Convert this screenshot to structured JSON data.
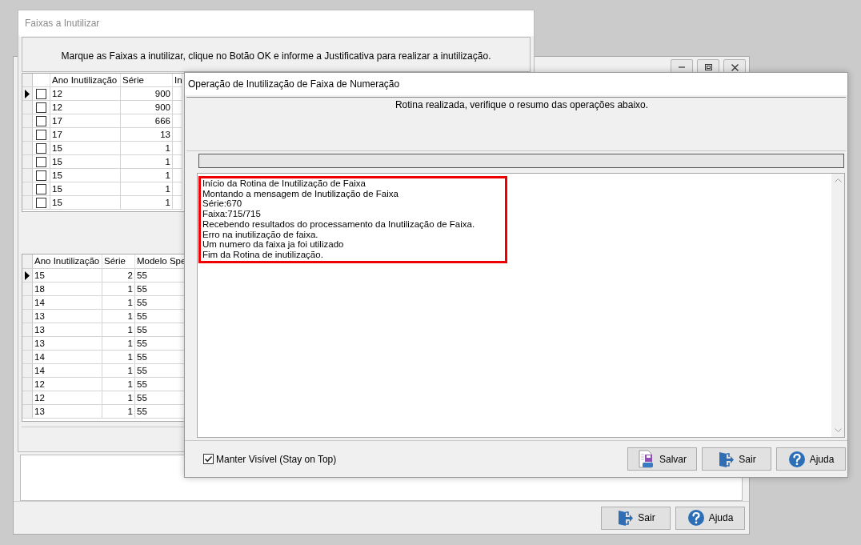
{
  "back_window": {
    "title_controls": [
      {
        "kind": "minimize"
      },
      {
        "kind": "maximize"
      },
      {
        "kind": "close"
      }
    ],
    "buttons": [
      {
        "label": "Sair",
        "kind": "exit"
      },
      {
        "label": "Ajuda",
        "kind": "help"
      }
    ]
  },
  "faixas_window": {
    "title": "Faixas a Inutilizar",
    "instruction": "Marque as Faixas a inutilizar, clique no Botão OK e informe a Justificativa para realizar a inutilização.",
    "grid_top": {
      "columns": [
        "Ano Inutilização",
        "Série",
        "In"
      ],
      "rows": [
        {
          "current": true,
          "checked": false,
          "cells": [
            "12",
            "900"
          ]
        },
        {
          "current": false,
          "checked": false,
          "cells": [
            "12",
            "900"
          ]
        },
        {
          "current": false,
          "checked": false,
          "cells": [
            "17",
            "666"
          ]
        },
        {
          "current": false,
          "checked": false,
          "cells": [
            "17",
            "13"
          ]
        },
        {
          "current": false,
          "checked": false,
          "cells": [
            "15",
            "1"
          ]
        },
        {
          "current": false,
          "checked": false,
          "cells": [
            "15",
            "1"
          ]
        },
        {
          "current": false,
          "checked": false,
          "cells": [
            "15",
            "1"
          ]
        },
        {
          "current": false,
          "checked": false,
          "cells": [
            "15",
            "1"
          ]
        },
        {
          "current": false,
          "checked": false,
          "cells": [
            "15",
            "1"
          ]
        }
      ]
    },
    "grid_bottom": {
      "columns": [
        "Ano Inutilização",
        "Série",
        "Modelo Spe"
      ],
      "rows": [
        {
          "current": true,
          "cells": [
            "15",
            "2",
            "55"
          ]
        },
        {
          "current": false,
          "cells": [
            "18",
            "1",
            "55"
          ]
        },
        {
          "current": false,
          "cells": [
            "14",
            "1",
            "55"
          ]
        },
        {
          "current": false,
          "cells": [
            "13",
            "1",
            "55"
          ]
        },
        {
          "current": false,
          "cells": [
            "13",
            "1",
            "55"
          ]
        },
        {
          "current": false,
          "cells": [
            "13",
            "1",
            "55"
          ]
        },
        {
          "current": false,
          "cells": [
            "14",
            "1",
            "55"
          ]
        },
        {
          "current": false,
          "cells": [
            "14",
            "1",
            "55"
          ]
        },
        {
          "current": false,
          "cells": [
            "12",
            "1",
            "55"
          ]
        },
        {
          "current": false,
          "cells": [
            "12",
            "1",
            "55"
          ]
        },
        {
          "current": false,
          "cells": [
            "13",
            "1",
            "55"
          ]
        }
      ]
    }
  },
  "dialog": {
    "title": "Operação de Inutilização de Faixa de Numeração",
    "message": "Rotina realizada, verifique o resumo das operações abaixo.",
    "progress": {
      "level": 0
    },
    "log": {
      "lines": [
        "Início da Rotina de Inutilização de Faixa",
        "Montando a mensagem de Inutilização de Faixa",
        "Série:670",
        "Faixa:715/715",
        "Recebendo resultados do processamento da Inutilização de Faixa.",
        "Erro na inutilização de faixa.",
        "Um numero da faixa ja foi utilizado",
        "Fim da Rotina de inutilização."
      ]
    },
    "stay_on_top": {
      "label": "Manter Visível (Stay on Top)",
      "checked": true
    },
    "buttons": [
      {
        "label": "Salvar",
        "kind": "save"
      },
      {
        "label": "Sair",
        "kind": "exit"
      },
      {
        "label": "Ajuda",
        "kind": "help"
      }
    ]
  }
}
